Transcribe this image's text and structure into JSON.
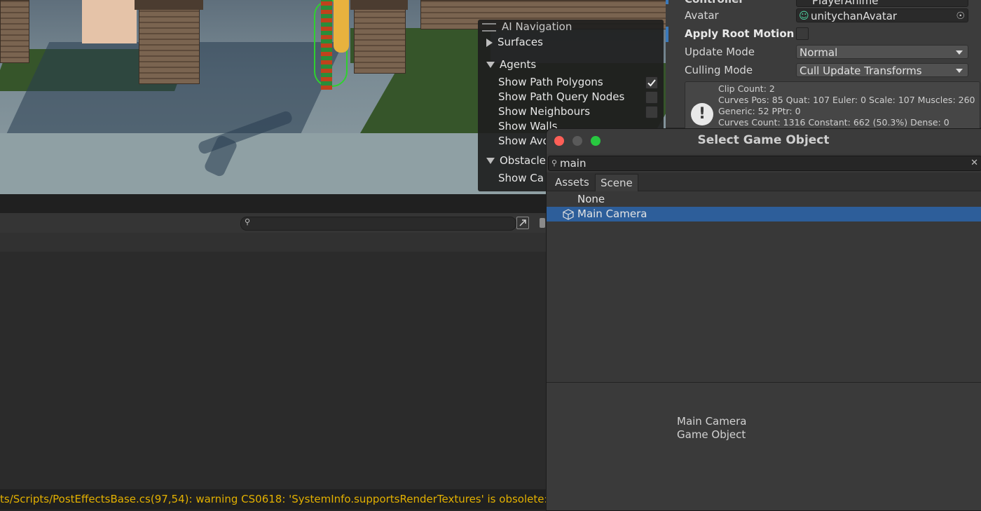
{
  "ai_navigation": {
    "title": "AI Navigation",
    "surfaces": "Surfaces",
    "agents": "Agents",
    "agent_options": [
      {
        "label": "Show Path Polygons",
        "checked": true
      },
      {
        "label": "Show Path Query Nodes",
        "checked": false
      },
      {
        "label": "Show Neighbours",
        "checked": false
      },
      {
        "label": "Show Walls",
        "checked": false
      },
      {
        "label": "Show Avo",
        "checked": false
      }
    ],
    "obstacles": "Obstacle",
    "obstacle_options": [
      {
        "label": "Show Ca"
      }
    ]
  },
  "inspector": {
    "controller_label": "Controller",
    "controller_value": "PlayerAnime",
    "avatar_label": "Avatar",
    "avatar_value": "unitychanAvatar",
    "apply_root_motion_label": "Apply Root Motion",
    "update_mode_label": "Update Mode",
    "update_mode_value": "Normal",
    "culling_mode_label": "Culling Mode",
    "culling_mode_value": "Cull Update Transforms",
    "info_lines": [
      "Clip Count: 2",
      "Curves Pos: 85 Quat: 107 Euler: 0 Scale: 107 Muscles: 260",
      "Generic: 52 PPtr: 0",
      "Curves Count: 1316 Constant: 662 (50.3%) Dense: 0"
    ]
  },
  "console": {
    "status_message": "ts/Scripts/PostEffectsBase.cs(97,54): warning CS0618: 'SystemInfo.supportsRenderTextures' is obsolete: 'su"
  },
  "picker": {
    "title": "Select Game Object",
    "search_value": "main",
    "tabs": [
      "Assets",
      "Scene"
    ],
    "active_tab": "Scene",
    "items": [
      {
        "label": "None",
        "selected": false
      },
      {
        "label": "Main Camera",
        "selected": true
      }
    ],
    "preview_name": "Main Camera",
    "preview_type": "Game Object"
  },
  "colors": {
    "warning": "#e2b000",
    "selection": "#2d5e9a",
    "close_light": "#ff5f57",
    "zoom_light": "#28c840"
  }
}
